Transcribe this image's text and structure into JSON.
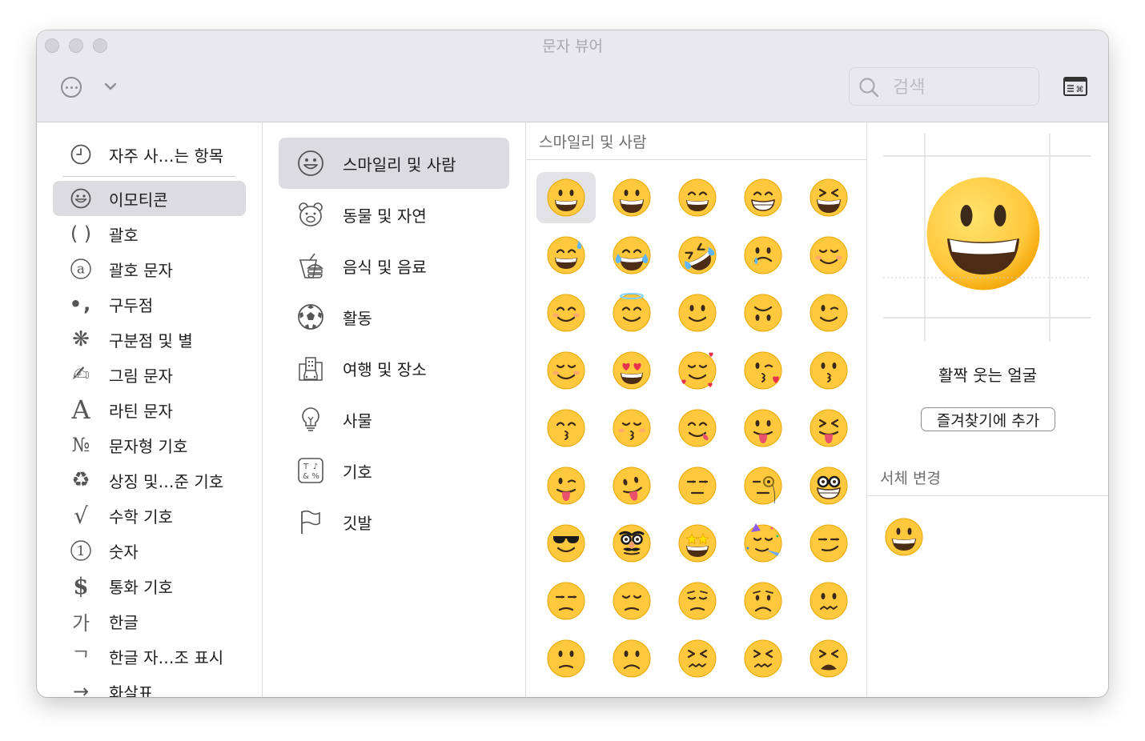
{
  "window": {
    "title": "문자 뷰어"
  },
  "toolbar": {
    "search_placeholder": "검색"
  },
  "sidebar": {
    "items": [
      {
        "icon": "clock-icon",
        "label": "자주 사…는 항목"
      },
      {
        "icon": "smiley-icon",
        "label": "이모티콘",
        "selected": true
      },
      {
        "icon": "parentheses-icon",
        "label": "괄호"
      },
      {
        "icon": "circled-a-icon",
        "label": "괄호 문자"
      },
      {
        "icon": "punctuation-icon",
        "label": "구두점"
      },
      {
        "icon": "asterisk-icon",
        "label": "구분점 및 별"
      },
      {
        "icon": "hand-writing-icon",
        "label": "그림 문자"
      },
      {
        "icon": "latin-a-icon",
        "label": "라틴 문자"
      },
      {
        "icon": "numero-icon",
        "label": "문자형 기호"
      },
      {
        "icon": "recycle-icon",
        "label": "상징 및…준 기호"
      },
      {
        "icon": "square-root-icon",
        "label": "수학 기호"
      },
      {
        "icon": "circled-one-icon",
        "label": "숫자"
      },
      {
        "icon": "dollar-icon",
        "label": "통화 기호"
      },
      {
        "icon": "hangul-ga-icon",
        "label": "한글"
      },
      {
        "icon": "hangul-jamo-icon",
        "label": "한글 자…조 표시"
      },
      {
        "icon": "arrow-right-icon",
        "label": "화살표"
      }
    ]
  },
  "categories": {
    "items": [
      {
        "icon": "smiley-outline-icon",
        "label": "스마일리 및 사람",
        "selected": true
      },
      {
        "icon": "bear-outline-icon",
        "label": "동물 및 자연"
      },
      {
        "icon": "food-outline-icon",
        "label": "음식 및 음료"
      },
      {
        "icon": "soccer-ball-icon",
        "label": "활동"
      },
      {
        "icon": "building-car-icon",
        "label": "여행 및 장소"
      },
      {
        "icon": "lightbulb-icon",
        "label": "사물"
      },
      {
        "icon": "symbols-icon",
        "label": "기호"
      },
      {
        "icon": "flag-icon",
        "label": "깃발"
      }
    ]
  },
  "emoji_section": {
    "title": "스마일리 및 사람"
  },
  "emoji_grid": [
    "grinning",
    "smiley",
    "smile",
    "grin",
    "laughing",
    "sweat-smile",
    "joy",
    "rofl",
    "holding-tears",
    "relaxed",
    "blush",
    "innocent",
    "slight-smile",
    "upside-down",
    "wink",
    "relieved",
    "heart-eyes",
    "smiling-hearts",
    "kissing-heart",
    "kissing",
    "kissing-smiling",
    "kissing-closed-eyes",
    "yum",
    "tongue",
    "squint-tongue",
    "wink-tongue",
    "zany",
    "raised-eyebrow",
    "monocle",
    "nerd",
    "sunglasses",
    "disguised",
    "star-struck",
    "partying",
    "smirk",
    "unamused",
    "disappointed",
    "pensive",
    "worried",
    "confused",
    "slight-frown",
    "frowning",
    "persevering",
    "confounded",
    "tired"
  ],
  "detail": {
    "name": "활짝 웃는 얼굴",
    "favorite_button": "즐겨찾기에 추가",
    "font_variation_title": "서체 변경"
  },
  "colors": {
    "selected_bg": "#dcdbdf",
    "titlebar": "#e9e8ec",
    "emoji_yellow": "#ffc83d"
  }
}
